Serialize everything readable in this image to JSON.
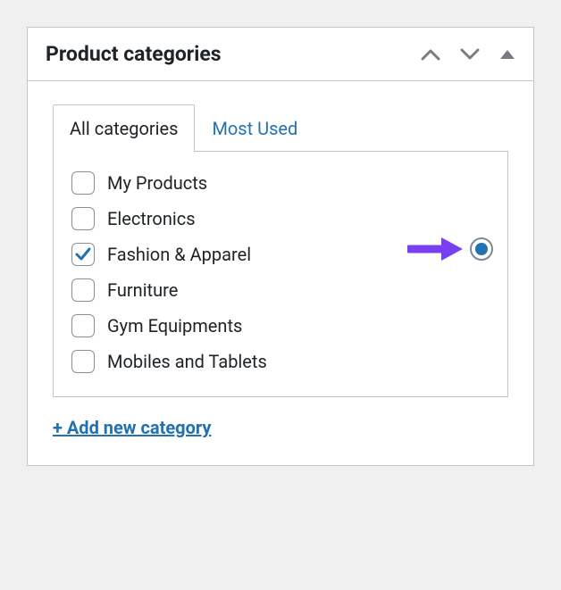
{
  "panel": {
    "title": "Product categories",
    "tabs": {
      "all": "All categories",
      "most_used": "Most Used"
    },
    "categories": [
      {
        "label": "My Products",
        "checked": false
      },
      {
        "label": "Electronics",
        "checked": false
      },
      {
        "label": "Fashion & Apparel",
        "checked": true
      },
      {
        "label": "Furniture",
        "checked": false
      },
      {
        "label": "Gym Equipments",
        "checked": false
      },
      {
        "label": "Mobiles and Tablets",
        "checked": false
      }
    ],
    "add_new_label": "+ Add new category",
    "accent_color": "#2271b1",
    "annotation_color": "#7b3ff2"
  }
}
